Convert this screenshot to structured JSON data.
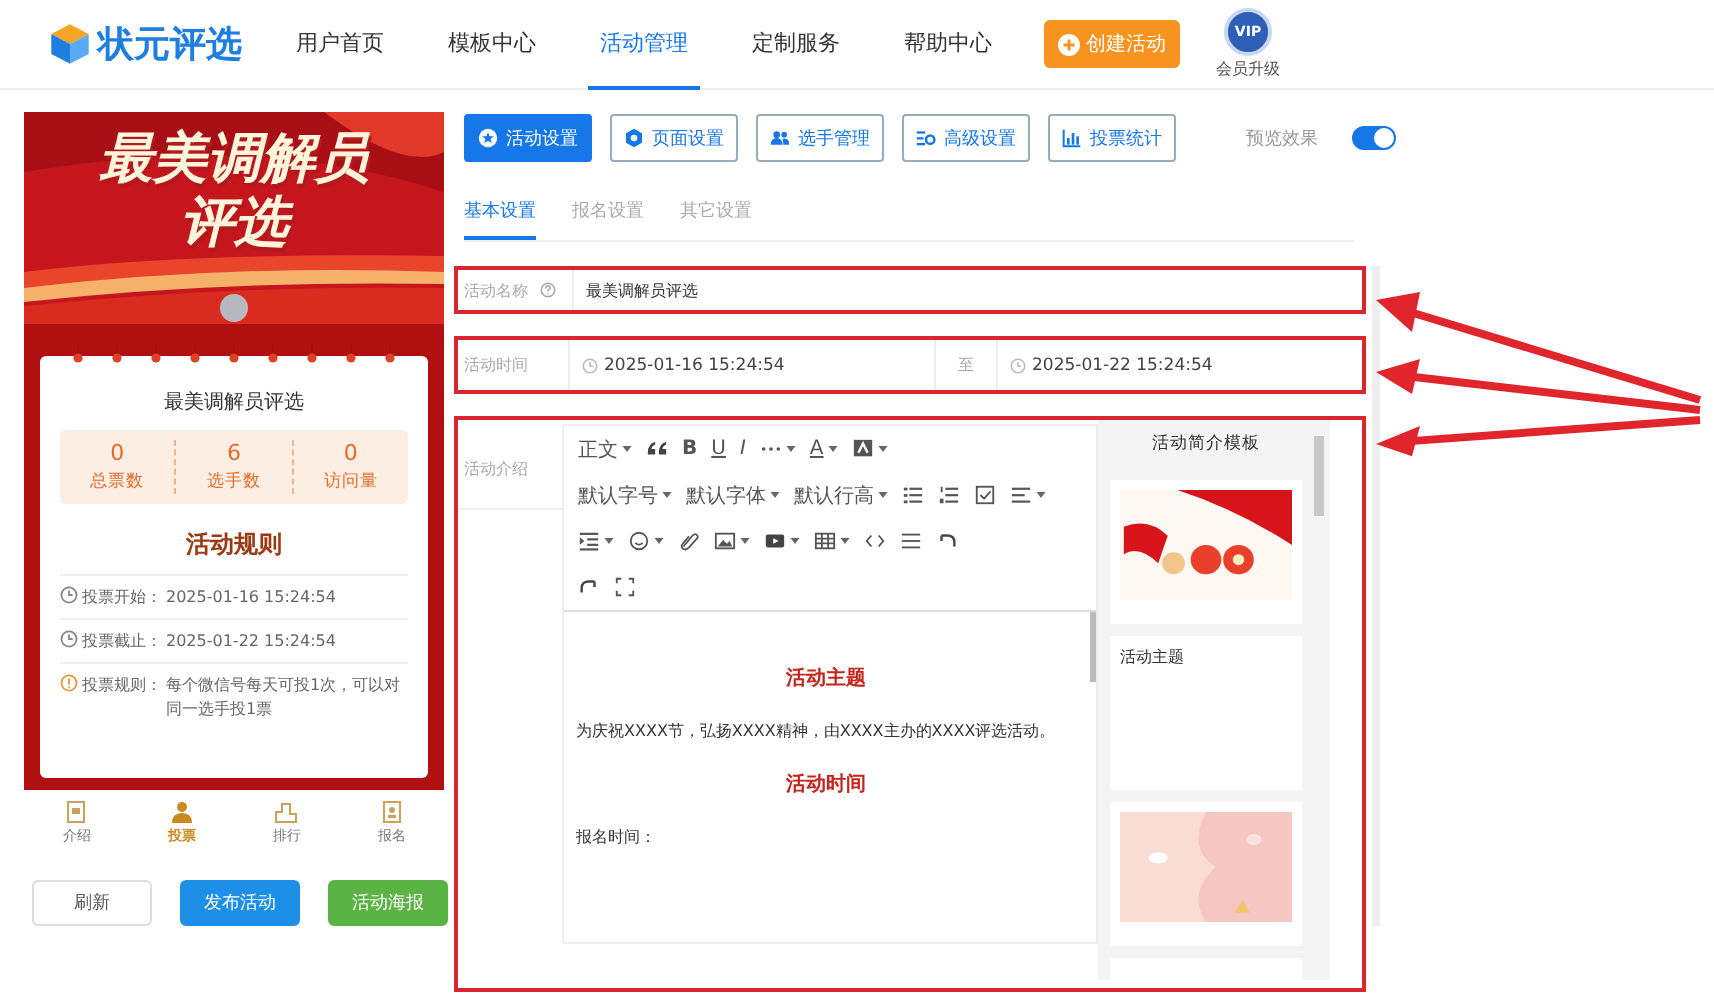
{
  "header": {
    "logo": "状元评选",
    "nav": [
      {
        "label": "用户首页",
        "selected": false
      },
      {
        "label": "模板中心",
        "selected": false
      },
      {
        "label": "活动管理",
        "selected": true
      },
      {
        "label": "定制服务",
        "selected": false
      },
      {
        "label": "帮助中心",
        "selected": false
      }
    ],
    "create_button": "创建活动",
    "vip": {
      "badge": "VIP",
      "label": "会员升级"
    }
  },
  "preview": {
    "banner_title": [
      "最美调解员",
      "评选"
    ],
    "title": "最美调解员评选",
    "stats": [
      {
        "value": "0",
        "label": "总票数"
      },
      {
        "value": "6",
        "label": "选手数"
      },
      {
        "value": "0",
        "label": "访问量"
      }
    ],
    "rules_title": "活动规则",
    "rules": [
      {
        "kind": "clock",
        "label": "投票开始：",
        "value": "2025-01-16 15:24:54"
      },
      {
        "kind": "clock",
        "label": "投票截止：",
        "value": "2025-01-22 15:24:54"
      },
      {
        "kind": "info",
        "label": "投票规则：",
        "value": "每个微信号每天可投1次，可以对同一选手投1票"
      }
    ],
    "nav": [
      {
        "label": "介绍",
        "selected": false
      },
      {
        "label": "投票",
        "selected": true
      },
      {
        "label": "排行",
        "selected": false
      },
      {
        "label": "报名",
        "selected": false
      }
    ],
    "buttons": [
      {
        "label": "刷新",
        "kind": "plain"
      },
      {
        "label": "发布活动",
        "kind": "primary"
      },
      {
        "label": "活动海报",
        "kind": "success"
      }
    ]
  },
  "settings": {
    "tabs": [
      {
        "label": "活动设置",
        "selected": true
      },
      {
        "label": "页面设置",
        "selected": false
      },
      {
        "label": "选手管理",
        "selected": false
      },
      {
        "label": "高级设置",
        "selected": false
      },
      {
        "label": "投票统计",
        "selected": false
      }
    ],
    "preview_toggle": {
      "label": "预览效果",
      "on": true
    },
    "subtabs": [
      {
        "label": "基本设置",
        "selected": true
      },
      {
        "label": "报名设置",
        "selected": false
      },
      {
        "label": "其它设置",
        "selected": false
      }
    ],
    "form": {
      "name": {
        "label": "活动名称",
        "value": "最美调解员评选",
        "highlighted": true
      },
      "time": {
        "label": "活动时间",
        "start": "2025-01-16 15:24:54",
        "separator": "至",
        "end": "2025-01-22 15:24:54",
        "highlighted": true
      },
      "intro": {
        "label": "活动介绍",
        "highlighted": true,
        "toolbar": {
          "style": "正文",
          "bold": "B",
          "underline": "U",
          "italic": "I",
          "font_color": "A",
          "font_size": "默认字号",
          "font_family": "默认字体",
          "line_height": "默认行高"
        },
        "content": [
          {
            "kind": "heading",
            "text": "活动主题"
          },
          {
            "kind": "paragraph",
            "text": "为庆祝XXXX节，弘扬XXXX精神，由XXXX主办的XXXX评选活动。"
          },
          {
            "kind": "heading",
            "text": "活动时间"
          },
          {
            "kind": "paragraph",
            "text": "报名时间："
          }
        ],
        "templates": {
          "title": "活动简介模板",
          "cards": [
            {
              "kind": "picture"
            },
            {
              "kind": "text",
              "text": "活动主题"
            },
            {
              "kind": "picture"
            },
            {
              "kind": "blank"
            }
          ]
        }
      }
    }
  }
}
